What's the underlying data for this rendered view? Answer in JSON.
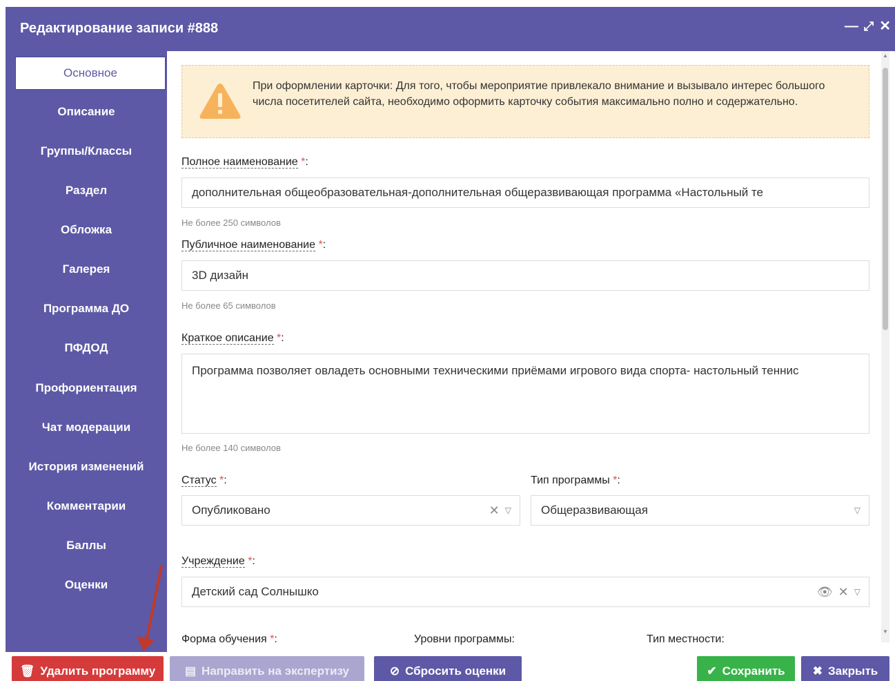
{
  "window": {
    "title": "Редактирование записи #888"
  },
  "sidebar": {
    "items": [
      {
        "label": "Основное"
      },
      {
        "label": "Описание"
      },
      {
        "label": "Группы/Классы"
      },
      {
        "label": "Раздел"
      },
      {
        "label": "Обложка"
      },
      {
        "label": "Галерея"
      },
      {
        "label": "Программа ДО"
      },
      {
        "label": "ПФДОД"
      },
      {
        "label": "Профориентация"
      },
      {
        "label": "Чат модерации"
      },
      {
        "label": "История изменений"
      },
      {
        "label": "Комментарии"
      },
      {
        "label": "Баллы"
      },
      {
        "label": "Оценки"
      }
    ]
  },
  "alert": {
    "text": "При оформлении карточки: Для того, чтобы мероприятие привлекало внимание и вызывало интерес большого числа посетителей сайта, необходимо оформить карточку события максимально полно и содержательно."
  },
  "form": {
    "full_name": {
      "label": "Полное наименование",
      "required": "*",
      "value": "дополнительная общеобразовательная-дополнительная общеразвивающая программа  «Настольный те",
      "hint": "Не более 250 символов"
    },
    "public_name": {
      "label": "Публичное наименование",
      "required": "*",
      "value": "3D дизайн",
      "hint": "Не более 65 символов"
    },
    "short_desc": {
      "label": "Краткое описание",
      "required": "*",
      "value": "Программа позволяет овладеть основными техническими приёмами игрового вида спорта- настольный теннис",
      "hint": "Не более 140 символов"
    },
    "status": {
      "label": "Статус",
      "required": "*",
      "value": "Опубликовано"
    },
    "program_type": {
      "label": "Тип программы",
      "required": "*",
      "value": "Общеразвивающая"
    },
    "institution": {
      "label": "Учреждение",
      "required": "*",
      "value": "Детский сад Солнышко"
    },
    "study_form": {
      "label": "Форма обучения",
      "required": "*"
    },
    "program_levels": {
      "label": "Уровни программы:"
    },
    "locality_type": {
      "label": "Тип местности:"
    },
    "colon": ":"
  },
  "footer": {
    "delete_label": "Удалить программу",
    "expertise_label": "Направить на экспертизу",
    "reset_label": "Сбросить оценки",
    "save_label": "Сохранить",
    "close_label": "Закрыть"
  },
  "colors": {
    "accent": "#5d59a6",
    "danger": "#d63b3b",
    "success": "#38b349",
    "alert_bg": "#fcefd4",
    "warning_icon": "#f7b35c"
  }
}
